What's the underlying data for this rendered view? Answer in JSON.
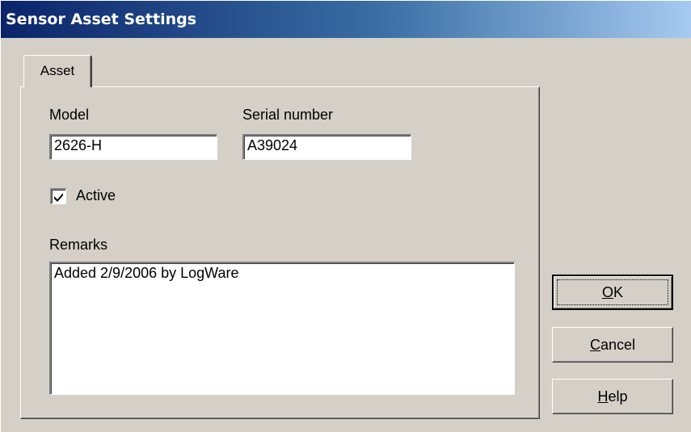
{
  "window": {
    "title": "Sensor Asset Settings"
  },
  "tabs": [
    {
      "label": "Asset",
      "selected": true
    }
  ],
  "form": {
    "model_label": "Model",
    "model_value": "2626-H",
    "serial_label": "Serial number",
    "serial_value": "A39024",
    "active_label": "Active",
    "active_checked": true,
    "remarks_label": "Remarks",
    "remarks_value": "Added 2/9/2006 by LogWare"
  },
  "buttons": {
    "ok": {
      "mnemonic": "O",
      "rest": "K",
      "default": true
    },
    "cancel": {
      "mnemonic": "C",
      "rest": "ancel"
    },
    "help": {
      "mnemonic": "H",
      "rest": "elp"
    }
  },
  "colors": {
    "title_gradient_start": "#0a246a",
    "title_gradient_end": "#a6caf0",
    "face": "#d4d0c8"
  }
}
